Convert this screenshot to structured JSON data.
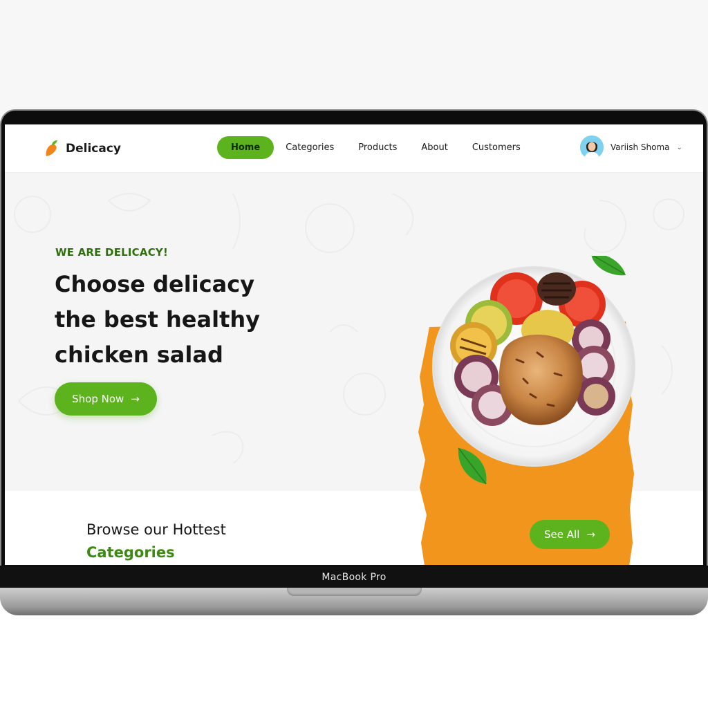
{
  "brand": {
    "name": "Delicacy",
    "logo_icon": "carrot-icon",
    "accent": "#5cb31e",
    "orange": "#f2951c"
  },
  "nav": {
    "items": [
      {
        "label": "Home",
        "active": true
      },
      {
        "label": "Categories",
        "active": false
      },
      {
        "label": "Products",
        "active": false
      },
      {
        "label": "About",
        "active": false
      },
      {
        "label": "Customers",
        "active": false
      }
    ]
  },
  "user": {
    "name": "Variish Shoma",
    "dropdown_icon": "chevron-down-icon"
  },
  "hero": {
    "eyebrow": "WE ARE DELICACY!",
    "headline": [
      "Choose delicacy",
      "the best healthy",
      "chicken salad"
    ],
    "cta": "Shop Now"
  },
  "browse": {
    "title": "Browse our Hottest",
    "subtitle": "Categories",
    "see_all": "See All"
  },
  "device_label": "MacBook Pro"
}
